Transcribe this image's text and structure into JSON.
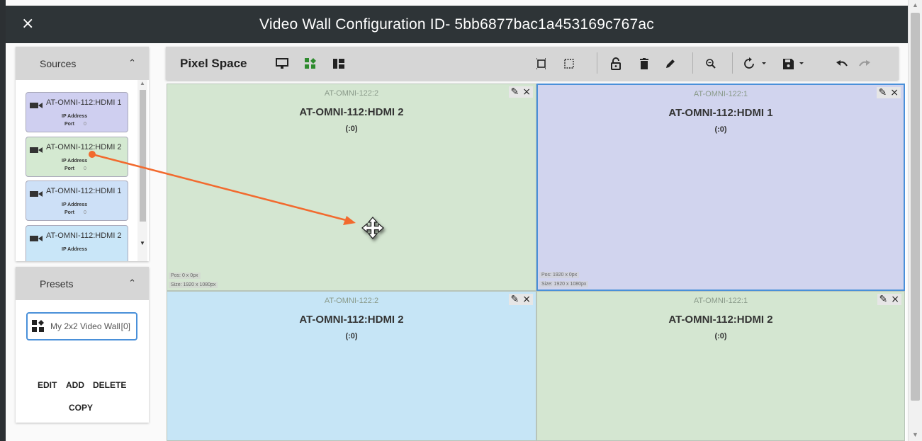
{
  "window": {
    "title": "Video Wall Configuration ID- 5bb6877bac1a453169c767ac",
    "close_glyph": "×"
  },
  "sources_panel": {
    "title": "Sources",
    "collapse_icon": "chevron-up-icon",
    "items": [
      {
        "name": "AT-OMNI-112:HDMI 1",
        "ip_label": "IP Address",
        "port_label": "Port",
        "port_value": "0",
        "color": "#cfcff0"
      },
      {
        "name": "AT-OMNI-112:HDMI 2",
        "ip_label": "IP Address",
        "port_label": "Port",
        "port_value": "0",
        "color": "#d4e9d1"
      },
      {
        "name": "AT-OMNI-112:HDMI 1",
        "ip_label": "IP Address",
        "port_label": "Port",
        "port_value": "0",
        "color": "#cde0f7"
      },
      {
        "name": "AT-OMNI-112:HDMI 2",
        "ip_label": "IP Address",
        "color": "#c9e6f8"
      }
    ]
  },
  "presets_panel": {
    "title": "Presets",
    "collapse_icon": "chevron-up-icon",
    "items": [
      {
        "name": "My 2x2 Video Wall",
        "count": "[0]"
      }
    ],
    "actions": {
      "edit": "EDIT",
      "add": "ADD",
      "delete": "DELETE",
      "copy": "COPY"
    }
  },
  "toolbar": {
    "title": "Pixel Space",
    "icons": [
      "monitor-icon",
      "grid-layout-icon",
      "layout-icon",
      "select-icon",
      "deselect-icon",
      "lock-open-icon",
      "delete-icon",
      "edit-icon",
      "zoom-icon",
      "refresh-icon",
      "save-icon",
      "undo-icon",
      "redo-icon"
    ]
  },
  "canvas": {
    "cells": [
      {
        "ip": "AT-OMNI-122:2",
        "source": "AT-OMNI-112:HDMI 2",
        "sub": "(:0)",
        "pos": "Pos: 0 x 0px",
        "size": "Size: 1920 x 1080px",
        "color": "#d4e6d1"
      },
      {
        "ip": "AT-OMNI-122:1",
        "source": "AT-OMNI-112:HDMI 1",
        "sub": "(:0)",
        "pos": "Pos: 1920 x 0px",
        "size": "Size: 1920 x 1080px",
        "color": "#d1d4ee"
      },
      {
        "ip": "AT-OMNI-122:2",
        "source": "AT-OMNI-112:HDMI 2",
        "sub": "(:0)",
        "color": "#c6e5f6"
      },
      {
        "ip": "AT-OMNI-122:1",
        "source": "AT-OMNI-112:HDMI 2",
        "sub": "(:0)",
        "color": "#d4e6d1"
      }
    ],
    "cell_edit_glyph": "✎",
    "cell_close_glyph": "×"
  },
  "colors": {
    "header": "#2e3437",
    "panel_head": "#d6d6d6",
    "accent_green": "#2e8b2e",
    "selection": "#4a90d9",
    "annotation_arrow": "#f26a2e"
  }
}
